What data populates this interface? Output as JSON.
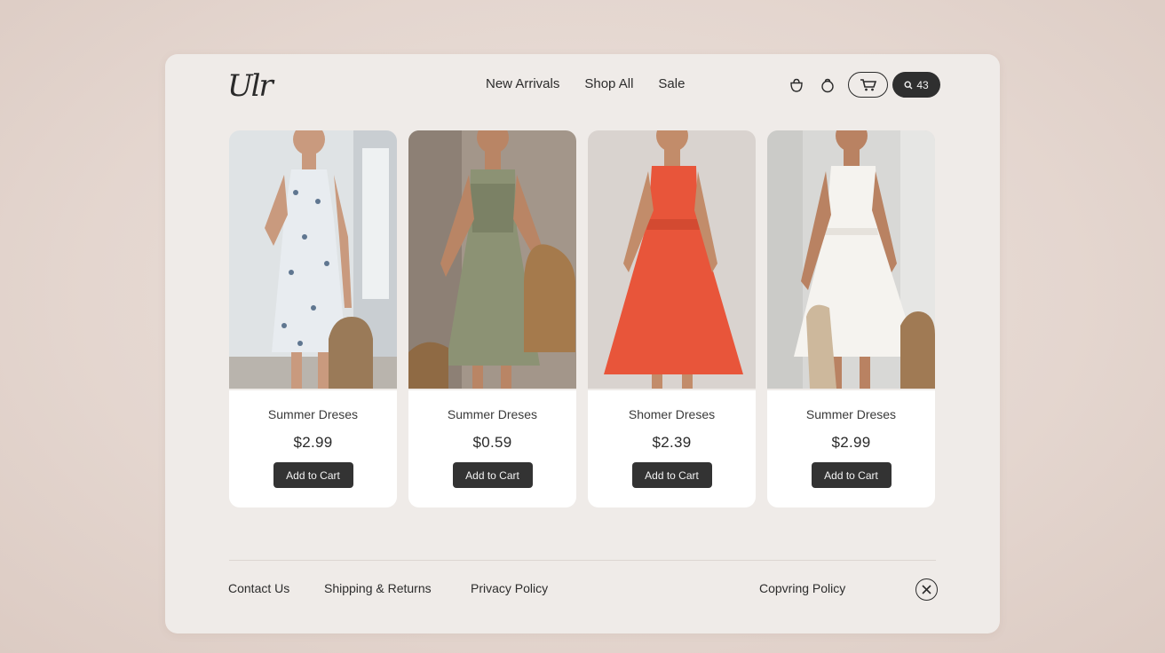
{
  "brand": {
    "logo_text": "Ulr"
  },
  "nav": {
    "items": [
      "New Arrivals",
      "Shop All",
      "Sale"
    ]
  },
  "header_icons": {
    "icon1": "bag-icon",
    "icon2": "bag-icon",
    "cart": "cart-icon",
    "search_label": "43"
  },
  "products": [
    {
      "name": "Summer Dreses",
      "price": "$2.99",
      "button": "Add to Cart",
      "dress_color": "#e8ecf0"
    },
    {
      "name": "Summer Dreses",
      "price": "$0.59",
      "button": "Add to Cart",
      "dress_color": "#8c9274"
    },
    {
      "name": "Shomer Dreses",
      "price": "$2.39",
      "button": "Add to Cart",
      "dress_color": "#e8553a"
    },
    {
      "name": "Summer Dreses",
      "price": "$2.99",
      "button": "Add to Cart",
      "dress_color": "#f5f3ef"
    }
  ],
  "footer": {
    "links": [
      "Contact Us",
      "Shipping & Returns",
      "Privacy Policy",
      "Copvring Policy"
    ]
  }
}
